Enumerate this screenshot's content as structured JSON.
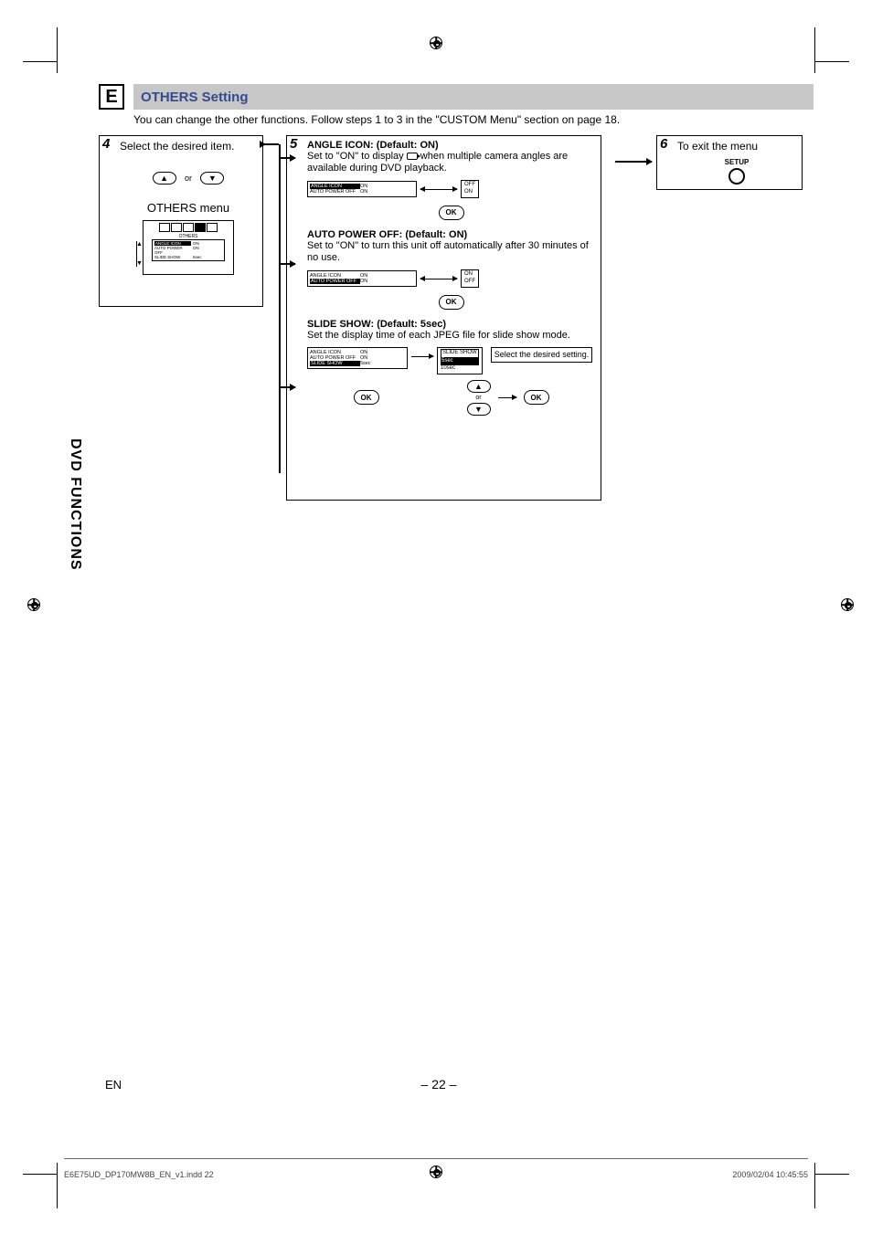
{
  "section_letter": "E",
  "section_title": "OTHERS Setting",
  "intro": "You can change the other functions. Follow steps 1 to 3 in the \"CUSTOM Menu\" section on page 18.",
  "side_tab": "DVD FUNCTIONS",
  "step4": {
    "num": "4",
    "text": "Select the desired item.",
    "or": "or",
    "menu_title": "OTHERS menu",
    "menu_sub": "OTHERS",
    "rows": [
      {
        "c1": "ANGLE ICON",
        "c2": "ON",
        "hl": true
      },
      {
        "c1": "AUTO POWER OFF",
        "c2": "ON",
        "hl": false
      },
      {
        "c1": "SLIDE SHOW",
        "c2": "5sec",
        "hl": false
      }
    ]
  },
  "step5": {
    "num": "5",
    "blocks": [
      {
        "title": "ANGLE ICON: (Default: ON)",
        "desc_a": "Set to \"ON\" to display ",
        "desc_b": " when multiple camera angles are available during DVD playback.",
        "menu": [
          {
            "m1": "ANGLE ICON",
            "m2": "ON",
            "hl": true
          },
          {
            "m1": "AUTO POWER OFF",
            "m2": "ON",
            "hl": false
          }
        ],
        "popup": [
          "OFF",
          "ON"
        ],
        "popup_hl": false,
        "ok": "OK"
      },
      {
        "title": "AUTO POWER OFF: (Default: ON)",
        "desc": "Set to \"ON\" to turn this unit off automatically after 30 minutes of no use.",
        "menu": [
          {
            "m1": "ANGLE ICON",
            "m2": "ON",
            "hl": false
          },
          {
            "m1": "AUTO POWER OFF",
            "m2": "ON",
            "hl": true
          }
        ],
        "popup": [
          "ON",
          "OFF"
        ],
        "popup_hl": false,
        "ok": "OK"
      },
      {
        "title": "SLIDE SHOW: (Default: 5sec)",
        "desc": "Set the display time of each JPEG file for slide show mode.",
        "menu": [
          {
            "m1": "ANGLE ICON",
            "m2": "ON",
            "hl": false
          },
          {
            "m1": "AUTO POWER OFF",
            "m2": "ON",
            "hl": false
          },
          {
            "m1": "SLIDE SHOW",
            "m2": "5sec",
            "hl": true
          }
        ],
        "popup_title": "SLIDE SHOW",
        "popup": [
          "5sec",
          "10sec"
        ],
        "side_text": "Select the desired setting.",
        "side_or": "or",
        "ok": "OK",
        "ok2": "OK"
      }
    ]
  },
  "step6": {
    "num": "6",
    "text": "To exit the menu",
    "btn_label": "SETUP"
  },
  "page_num": "– 22 –",
  "page_lang": "EN",
  "footer_left": "E6E75UD_DP170MW8B_EN_v1.indd   22",
  "footer_right": "2009/02/04   10:45:55"
}
